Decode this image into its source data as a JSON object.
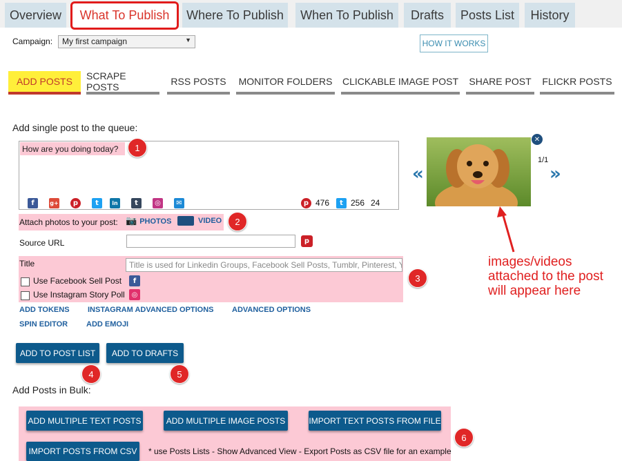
{
  "top_tabs": [
    {
      "label": "Overview"
    },
    {
      "label": "What To Publish",
      "active": true
    },
    {
      "label": "Where To Publish"
    },
    {
      "label": "When To Publish"
    },
    {
      "label": "Drafts"
    },
    {
      "label": "Posts List"
    },
    {
      "label": "History"
    }
  ],
  "campaign": {
    "label": "Campaign:",
    "value": "My first campaign"
  },
  "how_it_works": "HOW IT WORKS",
  "sub_tabs": [
    {
      "label": "ADD POSTS",
      "active": true
    },
    {
      "label": "SCRAPE POSTS"
    },
    {
      "label": "RSS POSTS"
    },
    {
      "label": "MONITOR FOLDERS"
    },
    {
      "label": "CLICKABLE IMAGE POST"
    },
    {
      "label": "SHARE POST"
    },
    {
      "label": "FLICKR POSTS"
    }
  ],
  "single": {
    "heading": "Add single post to the queue:",
    "text": "How are you doing today?",
    "counters": {
      "pinterest": "476",
      "twitter": "256",
      "other": "24"
    },
    "attach_label": "Attach photos to your post:",
    "photos": "PHOTOS",
    "video": "VIDEO",
    "source_url_label": "Source URL",
    "title_label": "Title",
    "title_placeholder": "Title is used for Linkedin Groups, Facebook Sell Posts, Tumblr, Pinterest, Yo",
    "fb_sell": "Use Facebook Sell Post",
    "ig_poll": "Use Instagram Story Poll",
    "links": [
      "ADD TOKENS",
      "INSTAGRAM ADVANCED OPTIONS",
      "ADVANCED OPTIONS",
      "SPIN EDITOR",
      "ADD EMOJI"
    ],
    "add_to_list": "ADD TO POST LIST",
    "add_to_drafts": "ADD TO DRAFTS"
  },
  "preview": {
    "counter": "1/1",
    "prev": "«",
    "next": "»",
    "close": "✕"
  },
  "annotation": {
    "line1": "images/videos",
    "line2": "attached to the post",
    "line3": "will appear here"
  },
  "bulk": {
    "heading": "Add Posts in Bulk:",
    "buttons": [
      "ADD MULTIPLE TEXT POSTS",
      "ADD MULTIPLE IMAGE POSTS",
      "IMPORT TEXT POSTS FROM FILE",
      "IMPORT POSTS FROM CSV"
    ],
    "note": "* use Posts Lists - Show Advanced View - Export Posts as CSV file for an example"
  },
  "badges": [
    "1",
    "2",
    "3",
    "4",
    "5",
    "6"
  ],
  "colors": {
    "accent": "#0d5a8c",
    "annotation": "#e02020",
    "highlight": "#fcc9d5",
    "tab_bg": "#d4e2ea"
  }
}
